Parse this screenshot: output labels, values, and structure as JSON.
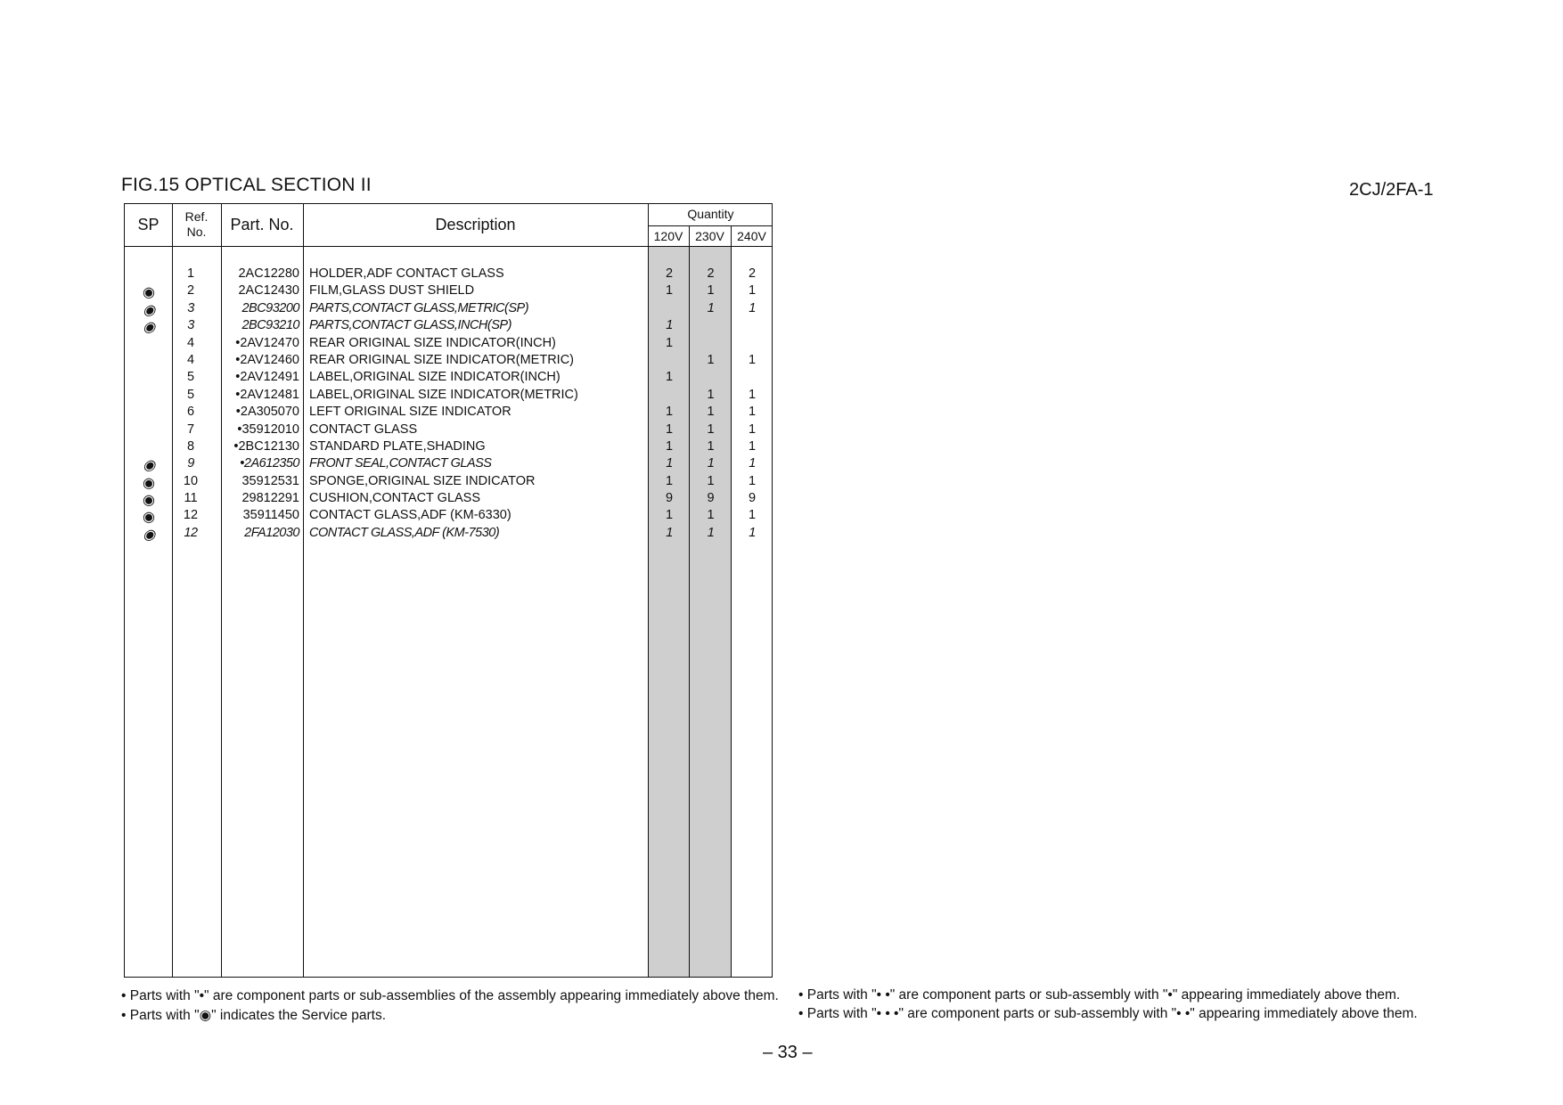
{
  "figure_title": "FIG.15  OPTICAL SECTION II",
  "doc_code": "2CJ/2FA-1",
  "table": {
    "headers": {
      "sp": "SP",
      "ref_line1": "Ref.",
      "ref_line2": "No.",
      "part_no": "Part. No.",
      "description": "Description",
      "quantity": "Quantity",
      "q120": "120V",
      "q230": "230V",
      "q240": "240V"
    },
    "rows": [
      {
        "sp": "",
        "ref": "1",
        "part": "2AC12280",
        "desc": "HOLDER,ADF CONTACT GLASS",
        "q120": "2",
        "q230": "2",
        "q240": "2",
        "italic": false
      },
      {
        "sp": "◉",
        "ref": "2",
        "part": "2AC12430",
        "desc": "FILM,GLASS DUST SHIELD",
        "q120": "1",
        "q230": "1",
        "q240": "1",
        "italic": false
      },
      {
        "sp": "◉",
        "ref": "3",
        "part": "2BC93200",
        "desc": "PARTS,CONTACT GLASS,METRIC(SP)",
        "q120": "",
        "q230": "1",
        "q240": "1",
        "italic": true
      },
      {
        "sp": "◉",
        "ref": "3",
        "part": "2BC93210",
        "desc": "PARTS,CONTACT GLASS,INCH(SP)",
        "q120": "1",
        "q230": "",
        "q240": "",
        "italic": true
      },
      {
        "sp": "",
        "ref": "4",
        "part": "•2AV12470",
        "desc": "REAR ORIGINAL SIZE INDICATOR(INCH)",
        "q120": "1",
        "q230": "",
        "q240": "",
        "italic": false
      },
      {
        "sp": "",
        "ref": "4",
        "part": "•2AV12460",
        "desc": "REAR ORIGINAL SIZE INDICATOR(METRIC)",
        "q120": "",
        "q230": "1",
        "q240": "1",
        "italic": false
      },
      {
        "sp": "",
        "ref": "5",
        "part": "•2AV12491",
        "desc": "LABEL,ORIGINAL SIZE INDICATOR(INCH)",
        "q120": "1",
        "q230": "",
        "q240": "",
        "italic": false
      },
      {
        "sp": "",
        "ref": "5",
        "part": "•2AV12481",
        "desc": "LABEL,ORIGINAL SIZE INDICATOR(METRIC)",
        "q120": "",
        "q230": "1",
        "q240": "1",
        "italic": false
      },
      {
        "sp": "",
        "ref": "6",
        "part": "•2A305070",
        "desc": "LEFT ORIGINAL SIZE INDICATOR",
        "q120": "1",
        "q230": "1",
        "q240": "1",
        "italic": false
      },
      {
        "sp": "",
        "ref": "7",
        "part": "•35912010",
        "desc": "CONTACT GLASS",
        "q120": "1",
        "q230": "1",
        "q240": "1",
        "italic": false
      },
      {
        "sp": "",
        "ref": "8",
        "part": "•2BC12130",
        "desc": "STANDARD PLATE,SHADING",
        "q120": "1",
        "q230": "1",
        "q240": "1",
        "italic": false
      },
      {
        "sp": "◉",
        "ref": "9",
        "part": "•2A612350",
        "desc": "FRONT SEAL,CONTACT GLASS",
        "q120": "1",
        "q230": "1",
        "q240": "1",
        "italic": true
      },
      {
        "sp": "◉",
        "ref": "10",
        "part": "35912531",
        "desc": "SPONGE,ORIGINAL SIZE INDICATOR",
        "q120": "1",
        "q230": "1",
        "q240": "1",
        "italic": false
      },
      {
        "sp": "◉",
        "ref": "11",
        "part": "29812291",
        "desc": "CUSHION,CONTACT GLASS",
        "q120": "9",
        "q230": "9",
        "q240": "9",
        "italic": false
      },
      {
        "sp": "◉",
        "ref": "12",
        "part": "35911450",
        "desc": "CONTACT GLASS,ADF (KM-6330)",
        "q120": "1",
        "q230": "1",
        "q240": "1",
        "italic": false
      },
      {
        "sp": "◉",
        "ref": "12",
        "part": "2FA12030",
        "desc": "CONTACT GLASS,ADF (KM-7530)",
        "q120": "1",
        "q230": "1",
        "q240": "1",
        "italic": true
      }
    ]
  },
  "notes": {
    "left": [
      "• Parts with \"•\" are component parts or sub-assemblies of the assembly appearing immediately above them.",
      "• Parts with \"◉\" indicates the Service parts."
    ],
    "right": [
      "• Parts with \"• •\" are component parts or sub-assembly with \"•\" appearing immediately above them.",
      "• Parts with \"• • •\" are component parts or sub-assembly with \"• •\" appearing immediately above them."
    ]
  },
  "page_number": "– 33 –",
  "colors": {
    "shade": "#cfcfcf",
    "ink": "#111111"
  }
}
